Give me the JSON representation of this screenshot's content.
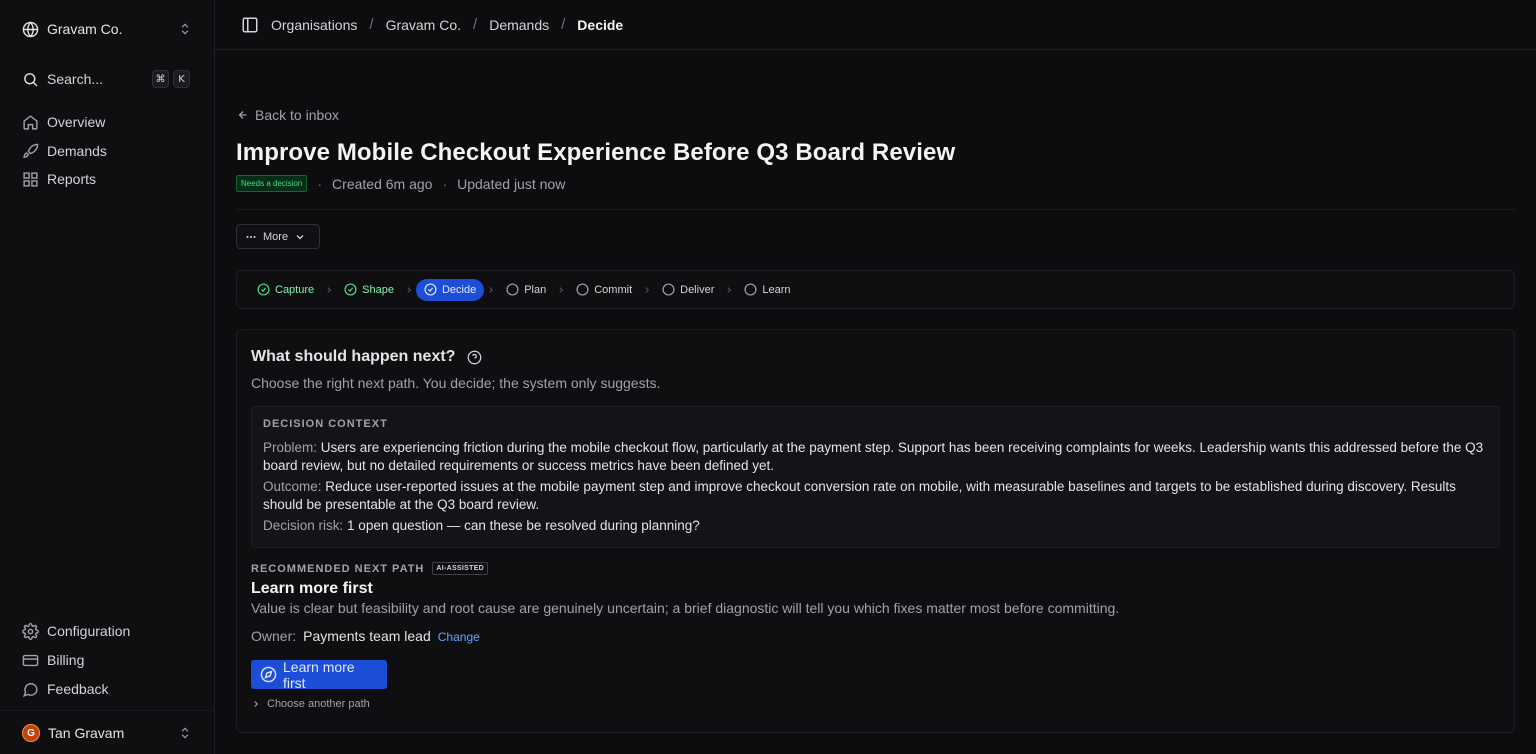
{
  "sidebar": {
    "org_name": "Gravam Co.",
    "search_label": "Search...",
    "shortcut_keys": [
      "⌘",
      "K"
    ],
    "nav": [
      {
        "label": "Overview",
        "icon": "home-icon"
      },
      {
        "label": "Demands",
        "icon": "rocket-icon"
      },
      {
        "label": "Reports",
        "icon": "grid-icon"
      }
    ],
    "bottom_nav": [
      {
        "label": "Configuration",
        "icon": "gear-icon"
      },
      {
        "label": "Billing",
        "icon": "credit-card-icon"
      },
      {
        "label": "Feedback",
        "icon": "chat-icon"
      }
    ],
    "user": {
      "name": "Tan Gravam",
      "initial": "G"
    }
  },
  "breadcrumb": [
    "Organisations",
    "Gravam Co.",
    "Demands",
    "Decide"
  ],
  "header": {
    "back_label": "Back to inbox",
    "title": "Improve Mobile Checkout Experience Before Q3 Board Review",
    "status_badge": "Needs a decision",
    "created": "Created 6m ago",
    "updated": "Updated just now",
    "more_label": "More"
  },
  "steps": [
    {
      "label": "Capture",
      "state": "done"
    },
    {
      "label": "Shape",
      "state": "done"
    },
    {
      "label": "Decide",
      "state": "active"
    },
    {
      "label": "Plan",
      "state": "pending"
    },
    {
      "label": "Commit",
      "state": "pending"
    },
    {
      "label": "Deliver",
      "state": "pending"
    },
    {
      "label": "Learn",
      "state": "pending"
    }
  ],
  "decision": {
    "question": "What should happen next?",
    "subtitle": "Choose the right next path. You decide; the system only suggests.",
    "context_heading": "DECISION CONTEXT",
    "problem_key": "Problem:",
    "problem": "Users are experiencing friction during the mobile checkout flow, particularly at the payment step. Support has been receiving complaints for weeks. Leadership wants this addressed before the Q3 board review, but no detailed requirements or success metrics have been defined yet.",
    "outcome_key": "Outcome:",
    "outcome": "Reduce user-reported issues at the mobile payment step and improve checkout conversion rate on mobile, with measurable baselines and targets to be established during discovery. Results should be presentable at the Q3 board review.",
    "risk_key": "Decision risk:",
    "risk": "1 open question — can these be resolved during planning?",
    "recommended_heading": "RECOMMENDED NEXT PATH",
    "ai_badge": "AI-ASSISTED",
    "recommendation_title": "Learn more first",
    "recommendation_desc": "Value is clear but feasibility and root cause are genuinely uncertain; a brief diagnostic will tell you which fixes matter most before committing.",
    "owner_key": "Owner:",
    "owner": "Payments team lead",
    "change_label": "Change",
    "primary_label": "Learn more first",
    "another_label": "Choose another path"
  },
  "colors": {
    "accent": "#1d4ed8",
    "success": "#4ade80",
    "link": "#60a5fa"
  }
}
